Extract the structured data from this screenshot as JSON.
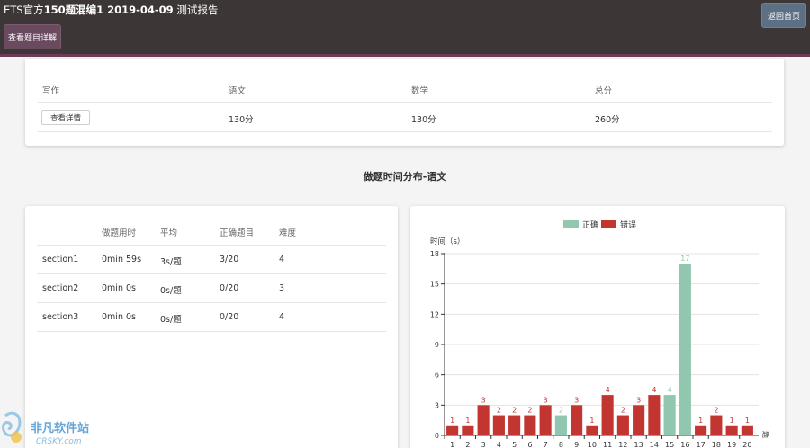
{
  "header": {
    "title_prefix": "ETS官方",
    "title_bold": "150题混编1 2019-04-09",
    "title_suffix": " 测试报告",
    "detail_button": "查看题目详解",
    "home_button": "返回首页"
  },
  "scores": {
    "headers": [
      "写作",
      "语文",
      "数学",
      "总分"
    ],
    "view_button": "查看详情",
    "values": [
      "130分",
      "130分",
      "260分"
    ]
  },
  "distribution_title": "做题时间分布-语文",
  "sections": {
    "headers": [
      "做题用时",
      "平均",
      "正确题目",
      "难度"
    ],
    "rows": [
      {
        "name": "section1",
        "time": "0min 59s",
        "avg": "3s/题",
        "correct": "3/20",
        "difficulty": "4"
      },
      {
        "name": "section2",
        "time": "0min 0s",
        "avg": "0s/题",
        "correct": "0/20",
        "difficulty": "3"
      },
      {
        "name": "section3",
        "time": "0min 0s",
        "avg": "0s/题",
        "correct": "0/20",
        "difficulty": "4"
      }
    ]
  },
  "chart_data": {
    "type": "bar",
    "categories": [
      "1",
      "2",
      "3",
      "4",
      "5",
      "6",
      "7",
      "8",
      "9",
      "10",
      "11",
      "12",
      "13",
      "14",
      "15",
      "16",
      "17",
      "18",
      "19",
      "20"
    ],
    "values": [
      1,
      1,
      3,
      2,
      2,
      2,
      3,
      2,
      3,
      1,
      4,
      2,
      3,
      4,
      4,
      17,
      1,
      2,
      1,
      1
    ],
    "status": [
      "错误",
      "错误",
      "错误",
      "错误",
      "错误",
      "错误",
      "错误",
      "正确",
      "错误",
      "错误",
      "错误",
      "错误",
      "错误",
      "错误",
      "正确",
      "正确",
      "错误",
      "错误",
      "错误",
      "错误"
    ],
    "legend": [
      "正确",
      "错误"
    ],
    "legend_placement": "top-center",
    "colors": {
      "正确": "#91c7ae",
      "错误": "#c23531"
    },
    "ylabel": "时间（s）",
    "xlabel": "题",
    "ylim": [
      0,
      18
    ],
    "yticks": [
      "0",
      "3",
      "6",
      "9",
      "12",
      "15",
      "18"
    ],
    "grid": true
  },
  "watermark": {
    "name": "非凡软件站",
    "site": "CRSKY.com"
  }
}
